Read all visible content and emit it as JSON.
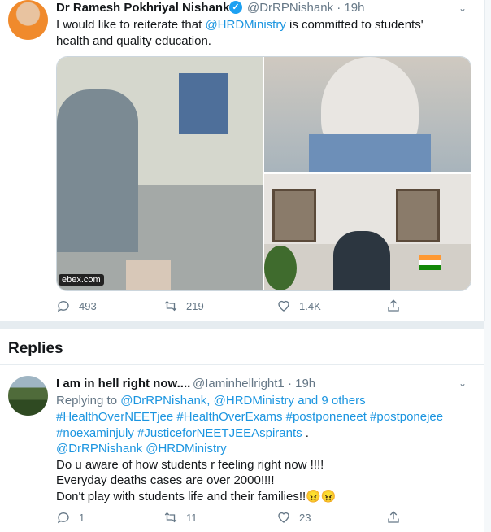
{
  "tweet": {
    "author_name": "Dr Ramesh Pokhriyal Nishank",
    "handle_time": "@DrRPNishank · 19h",
    "text_1": "I would like to reiterate that ",
    "mention": "@HRDMinistry",
    "text_2": " is committed to students'",
    "text_3": "health and quality education.",
    "media_watermark": "ebex.com",
    "replies_count": "493",
    "retweets_count": "219",
    "likes_count": "1.4K"
  },
  "replies_section": {
    "title": "Replies"
  },
  "reply": {
    "author_name": "I am in hell right now....",
    "handle_time": "@Iaminhellright1 · 19h",
    "replying_prefix": "Replying to ",
    "replying_targets": "@DrRPNishank, @HRDMinistry and 9 others",
    "hashtags_line1": "#HealthOverNEETjee #HealthOverExams #postponeneet #postponejee",
    "hashtags_line2": "#noexaminjuly #JusticeforNEETJEEAspirants",
    "hashtags_line2_end": " .",
    "mentions_line": "@DrRPNishank @HRDMinistry",
    "line_1": "Do u aware of how students r feeling right now !!!!",
    "line_2": "Everyday deaths cases are over 2000!!!!",
    "line_3": "Don't play with students life and their families!!😠😠",
    "replies_count": "1",
    "retweets_count": "11",
    "likes_count": "23"
  }
}
